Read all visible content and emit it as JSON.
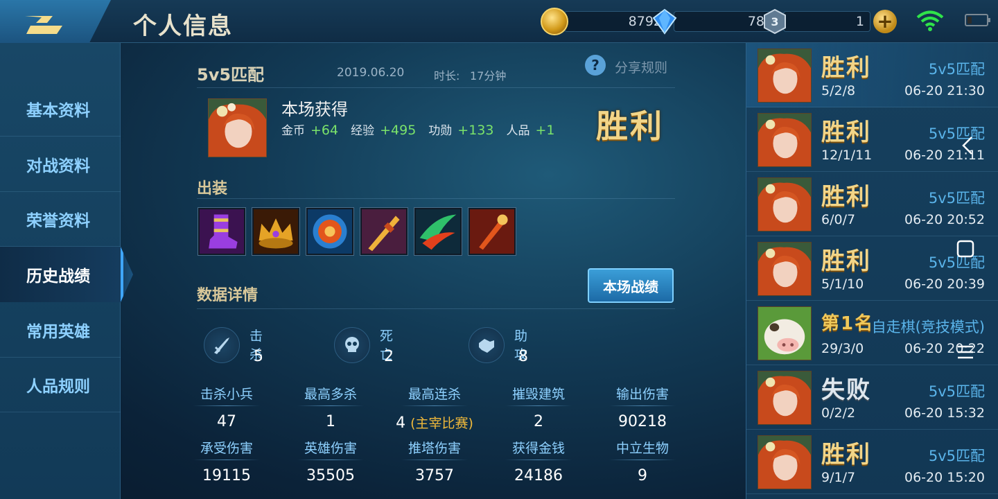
{
  "header": {
    "title": "个人信息",
    "gold": "8792",
    "diamonds": "78",
    "tickets": "1"
  },
  "sidebar": {
    "items": [
      {
        "label": "基本资料"
      },
      {
        "label": "对战资料"
      },
      {
        "label": "荣誉资料"
      },
      {
        "label": "历史战绩"
      },
      {
        "label": "常用英雄"
      },
      {
        "label": "人品规则"
      }
    ]
  },
  "match": {
    "mode": "5v5匹配",
    "date": "2019.06.20",
    "duration_label": "时长:",
    "duration": "17分钟",
    "share_rule": "分享规则",
    "earn_title": "本场获得",
    "rewards": [
      {
        "label": "金币",
        "value": "+64"
      },
      {
        "label": "经验",
        "value": "+495"
      },
      {
        "label": "功勋",
        "value": "+133"
      },
      {
        "label": "人品",
        "value": "+1"
      }
    ],
    "result": "胜利",
    "equip_title": "出装",
    "details_title": "数据详情",
    "record_button": "本场战绩",
    "kda": [
      {
        "label": "击杀",
        "value": "5"
      },
      {
        "label": "死亡",
        "value": "2"
      },
      {
        "label": "助攻",
        "value": "8"
      }
    ],
    "stats": [
      {
        "label": "击杀小兵",
        "value": "47"
      },
      {
        "label": "最高多杀",
        "value": "1"
      },
      {
        "label": "最高连杀",
        "value": "4",
        "extra": "(主宰比赛)"
      },
      {
        "label": "摧毁建筑",
        "value": "2"
      },
      {
        "label": "输出伤害",
        "value": "90218"
      },
      {
        "label": "承受伤害",
        "value": "19115"
      },
      {
        "label": "英雄伤害",
        "value": "35505"
      },
      {
        "label": "推塔伤害",
        "value": "3757"
      },
      {
        "label": "获得金钱",
        "value": "24186"
      },
      {
        "label": "中立生物",
        "value": "9"
      }
    ]
  },
  "history": [
    {
      "result": "胜利",
      "mode": "5v5匹配",
      "kda": "5/2/8",
      "time": "06-20 21:30"
    },
    {
      "result": "胜利",
      "mode": "5v5匹配",
      "kda": "12/1/11",
      "time": "06-20 21:11"
    },
    {
      "result": "胜利",
      "mode": "5v5匹配",
      "kda": "6/0/7",
      "time": "06-20 20:52"
    },
    {
      "result": "胜利",
      "mode": "5v5匹配",
      "kda": "5/1/10",
      "time": "06-20 20:39"
    },
    {
      "result": "第1名",
      "mode": "自走棋(竞技模式)",
      "kda": "29/3/0",
      "time": "06-20 20:22"
    },
    {
      "result": "失败",
      "mode": "5v5匹配",
      "kda": "0/2/2",
      "time": "06-20 15:32"
    },
    {
      "result": "胜利",
      "mode": "5v5匹配",
      "kda": "9/1/7",
      "time": "06-20 15:20"
    }
  ]
}
